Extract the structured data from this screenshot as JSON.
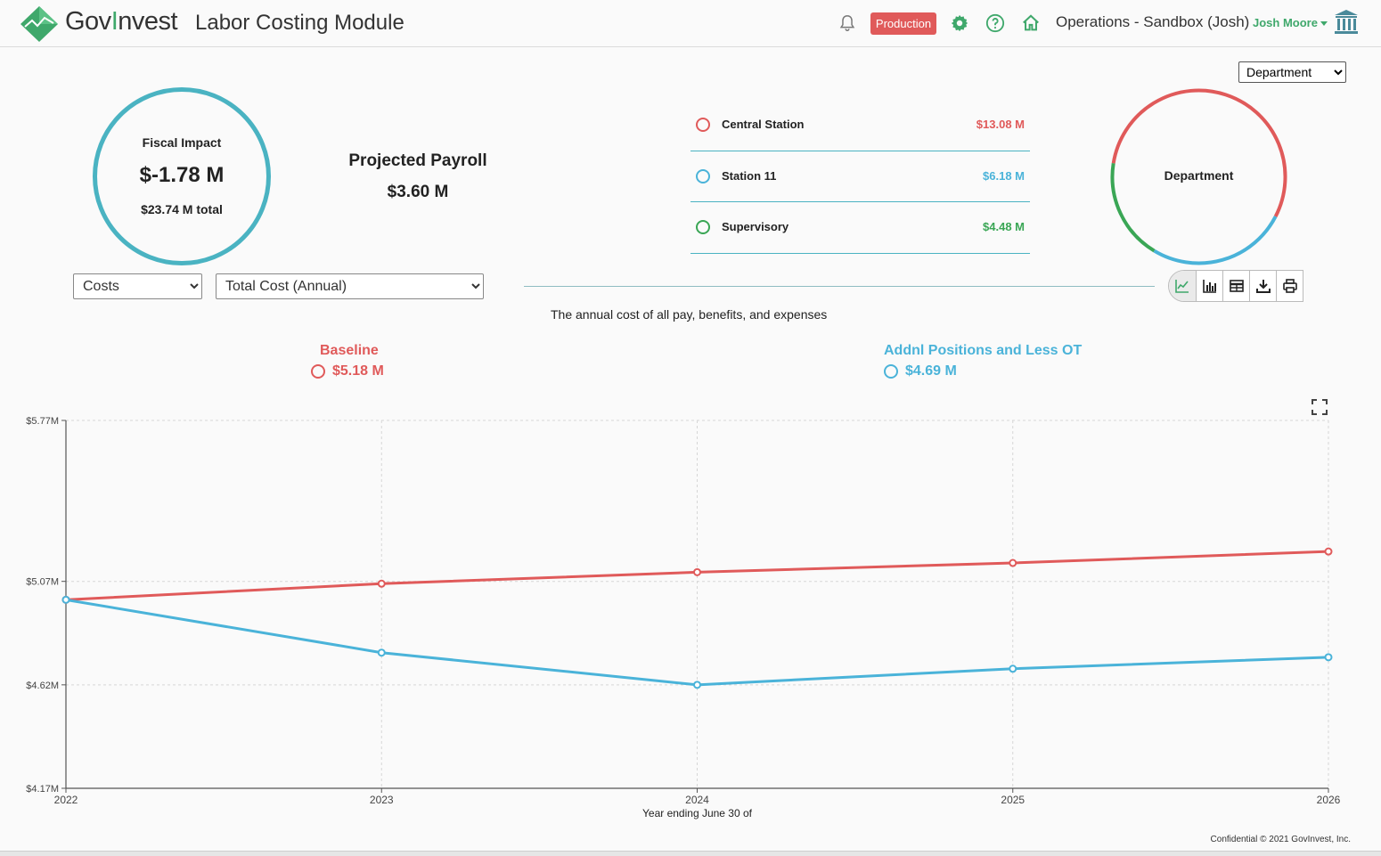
{
  "header": {
    "brand_prefix": "Gov",
    "brand_accent": "I",
    "brand_suffix": "nvest",
    "module_title": "Labor Costing Module",
    "environment_badge": "Production",
    "workspace": "Operations - Sandbox (Josh)",
    "user": "Josh Moore",
    "icons": [
      "bell-icon",
      "gear-icon",
      "help-icon",
      "home-icon",
      "institution-icon"
    ]
  },
  "summary": {
    "grouping_select": {
      "selected": "Department"
    },
    "fiscal_impact": {
      "label": "Fiscal Impact",
      "value": "$-1.78 M",
      "total": "$23.74 M total"
    },
    "projected_payroll": {
      "label": "Projected Payroll",
      "value": "$3.60 M"
    },
    "departments": [
      {
        "name": "Central Station",
        "amount": "$13.08 M",
        "color": "#e05a5a"
      },
      {
        "name": "Station 11",
        "amount": "$6.18 M",
        "color": "#4ab3d9"
      },
      {
        "name": "Supervisory",
        "amount": "$4.48 M",
        "color": "#3aa655"
      }
    ],
    "donut_label": "Department",
    "donut_shares": [
      13.08,
      6.18,
      4.48
    ]
  },
  "controls": {
    "category_select": "Costs",
    "metric_select": "Total Cost (Annual)",
    "description": "The annual cost of all pay, benefits, and expenses",
    "toolbar": [
      "line-chart-icon",
      "bar-chart-icon",
      "table-icon",
      "download-icon",
      "print-icon"
    ]
  },
  "legend": [
    {
      "name": "Baseline",
      "value": "$5.18 M",
      "color": "#e05a5a"
    },
    {
      "name": "Addnl Positions and Less OT",
      "value": "$4.69 M",
      "color": "#4ab3d9"
    }
  ],
  "chart_data": {
    "type": "line",
    "x": [
      "2022",
      "2023",
      "2024",
      "2025",
      "2026"
    ],
    "xlabel": "Year ending June 30 of",
    "ylabel": "",
    "y_ticks": [
      "$4.17M",
      "$4.62M",
      "$5.07M",
      "$5.77M"
    ],
    "y_tick_values": [
      4.17,
      4.62,
      5.07,
      5.77
    ],
    "ylim": [
      4.17,
      5.77
    ],
    "grid": true,
    "series": [
      {
        "name": "Baseline",
        "color": "#e05a5a",
        "values": [
          4.99,
          5.06,
          5.11,
          5.15,
          5.2
        ]
      },
      {
        "name": "Addnl Positions and Less OT",
        "color": "#4ab3d9",
        "values": [
          4.99,
          4.76,
          4.62,
          4.69,
          4.74
        ]
      }
    ]
  },
  "footer": "Confidential © 2021 GovInvest, Inc."
}
